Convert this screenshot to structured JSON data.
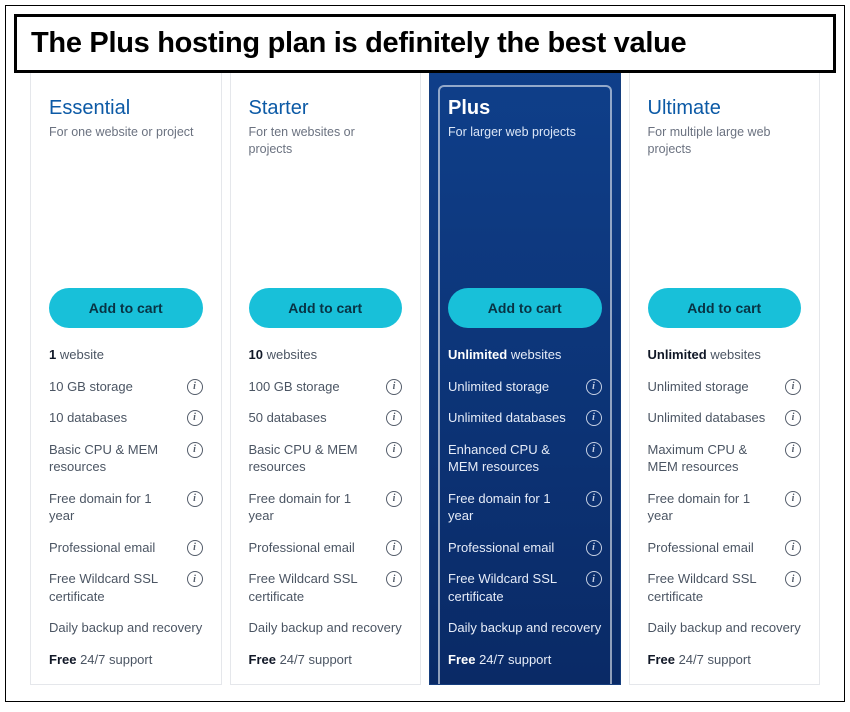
{
  "banner": "The Plus hosting plan is definitely the best value",
  "cta_label": "Add to cart",
  "plans": [
    {
      "id": "essential",
      "name": "Essential",
      "subtitle": "For one website or project",
      "highlight": false,
      "features": [
        {
          "bold": "1",
          "text": " website",
          "info": false
        },
        {
          "bold": "",
          "text": "10 GB storage",
          "info": true
        },
        {
          "bold": "",
          "text": "10 databases",
          "info": true
        },
        {
          "bold": "",
          "text": "Basic CPU & MEM resources",
          "info": true
        },
        {
          "bold": "",
          "text": "Free domain for 1 year",
          "info": true
        },
        {
          "bold": "",
          "text": "Professional email",
          "info": true
        },
        {
          "bold": "",
          "text": "Free Wildcard SSL certificate",
          "info": true
        },
        {
          "bold": "",
          "text": "Daily backup and recovery",
          "info": false
        },
        {
          "bold": "Free",
          "text": " 24/7 support",
          "info": false
        }
      ]
    },
    {
      "id": "starter",
      "name": "Starter",
      "subtitle": "For ten websites or projects",
      "highlight": false,
      "features": [
        {
          "bold": "10",
          "text": " websites",
          "info": false
        },
        {
          "bold": "",
          "text": "100 GB storage",
          "info": true
        },
        {
          "bold": "",
          "text": "50 databases",
          "info": true
        },
        {
          "bold": "",
          "text": "Basic CPU & MEM resources",
          "info": true
        },
        {
          "bold": "",
          "text": "Free domain for 1 year",
          "info": true
        },
        {
          "bold": "",
          "text": "Professional email",
          "info": true
        },
        {
          "bold": "",
          "text": "Free Wildcard SSL certificate",
          "info": true
        },
        {
          "bold": "",
          "text": "Daily backup and recovery",
          "info": false
        },
        {
          "bold": "Free",
          "text": " 24/7 support",
          "info": false
        }
      ]
    },
    {
      "id": "plus",
      "name": "Plus",
      "subtitle": "For larger web projects",
      "highlight": true,
      "features": [
        {
          "bold": "Unlimited",
          "text": " websites",
          "info": false
        },
        {
          "bold": "",
          "text": "Unlimited storage",
          "info": true
        },
        {
          "bold": "",
          "text": "Unlimited databases",
          "info": true
        },
        {
          "bold": "",
          "text": "Enhanced CPU & MEM resources",
          "info": true
        },
        {
          "bold": "",
          "text": "Free domain for 1 year",
          "info": true
        },
        {
          "bold": "",
          "text": "Professional email",
          "info": true
        },
        {
          "bold": "",
          "text": "Free Wildcard SSL certificate",
          "info": true
        },
        {
          "bold": "",
          "text": "Daily backup and recovery",
          "info": false
        },
        {
          "bold": "Free",
          "text": " 24/7 support",
          "info": false
        }
      ]
    },
    {
      "id": "ultimate",
      "name": "Ultimate",
      "subtitle": "For multiple large web projects",
      "highlight": false,
      "features": [
        {
          "bold": "Unlimited",
          "text": " websites",
          "info": false
        },
        {
          "bold": "",
          "text": "Unlimited storage",
          "info": true
        },
        {
          "bold": "",
          "text": "Unlimited databases",
          "info": true
        },
        {
          "bold": "",
          "text": "Maximum CPU & MEM resources",
          "info": true
        },
        {
          "bold": "",
          "text": "Free domain for 1 year",
          "info": true
        },
        {
          "bold": "",
          "text": "Professional email",
          "info": true
        },
        {
          "bold": "",
          "text": "Free Wildcard SSL certificate",
          "info": true
        },
        {
          "bold": "",
          "text": "Daily backup and recovery",
          "info": false
        },
        {
          "bold": "Free",
          "text": " 24/7 support",
          "info": false
        }
      ]
    }
  ]
}
